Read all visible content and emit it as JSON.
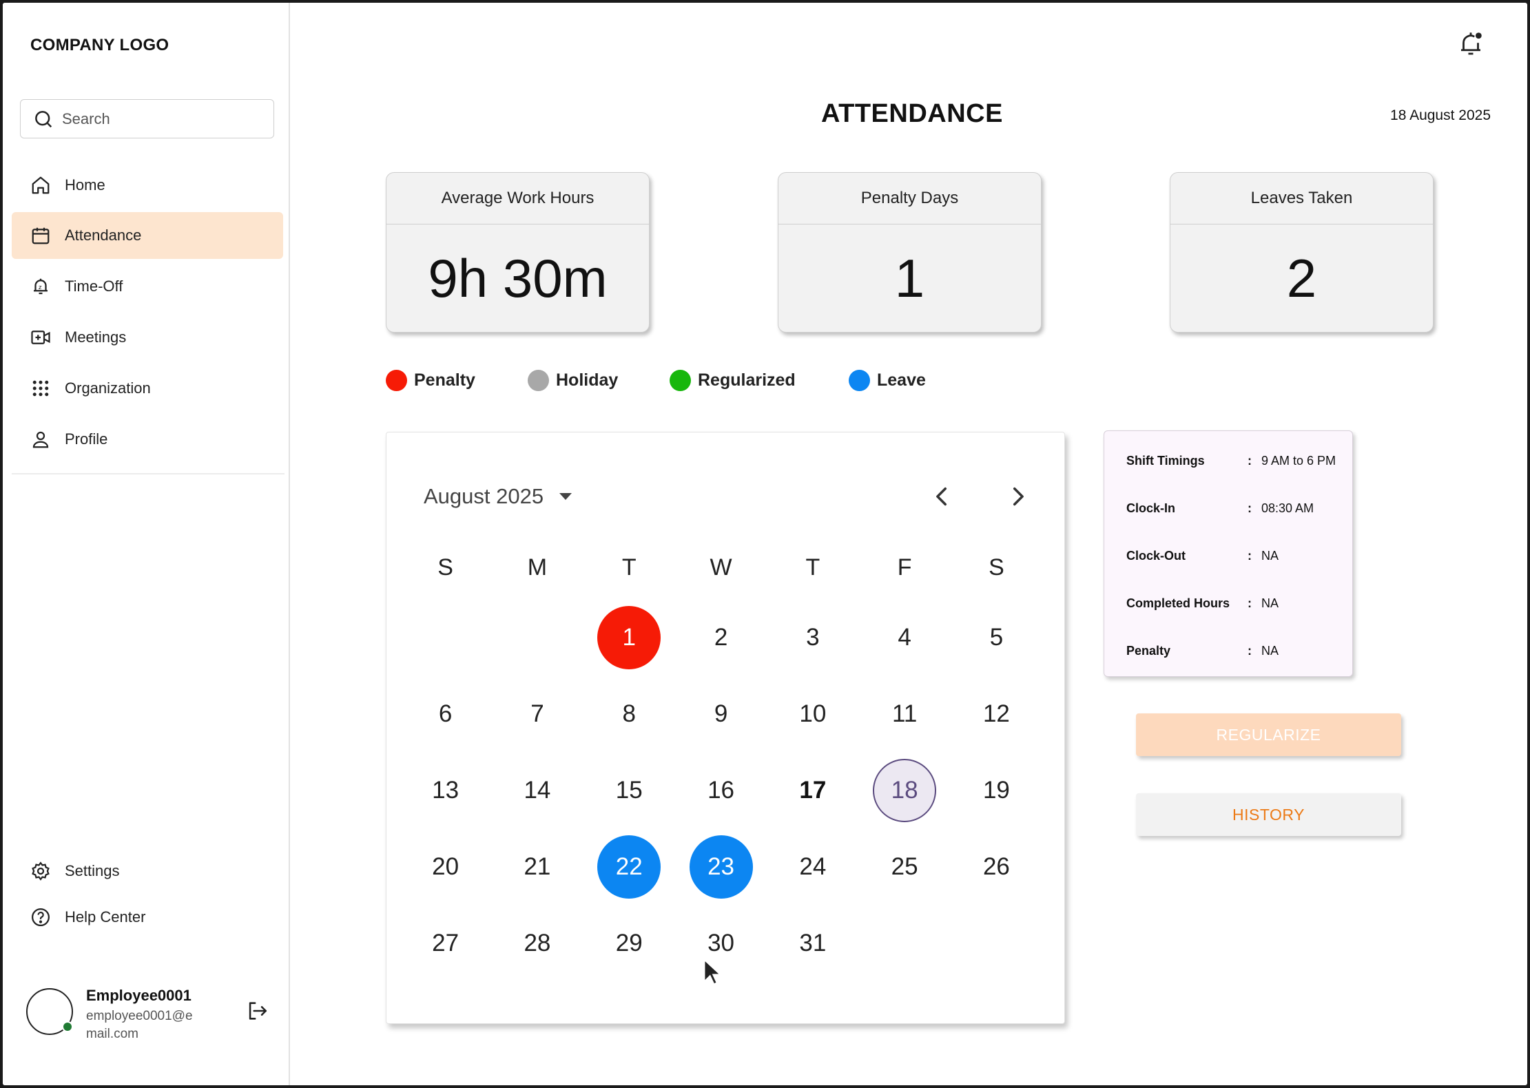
{
  "sidebar": {
    "logo": "COMPANY LOGO",
    "search_placeholder": "Search",
    "nav": [
      {
        "label": "Home",
        "icon": "home-icon"
      },
      {
        "label": "Attendance",
        "icon": "calendar-icon",
        "active": true
      },
      {
        "label": "Time-Off",
        "icon": "time-off-icon"
      },
      {
        "label": "Meetings",
        "icon": "video-add-icon"
      },
      {
        "label": "Organization",
        "icon": "grid-dots-icon"
      },
      {
        "label": "Profile",
        "icon": "user-icon"
      }
    ],
    "bottom_nav": [
      {
        "label": "Settings",
        "icon": "gear-icon"
      },
      {
        "label": "Help Center",
        "icon": "help-circle-icon"
      }
    ],
    "user": {
      "name": "Employee0001",
      "email": "employee0001@email.com",
      "status_color": "#1f7a33"
    }
  },
  "header": {
    "title": "ATTENDANCE",
    "date": "18 August 2025"
  },
  "stats": [
    {
      "label": "Average Work Hours",
      "value": "9h 30m"
    },
    {
      "label": "Penalty Days",
      "value": "1"
    },
    {
      "label": "Leaves Taken",
      "value": "2"
    }
  ],
  "legend": [
    {
      "label": "Penalty",
      "color": "#f61b06"
    },
    {
      "label": "Holiday",
      "color": "#a8a8a8"
    },
    {
      "label": "Regularized",
      "color": "#17b70c"
    },
    {
      "label": "Leave",
      "color": "#0c86f2"
    }
  ],
  "calendar": {
    "month_label": "August 2025",
    "weekdays": [
      "S",
      "M",
      "T",
      "W",
      "T",
      "F",
      "S"
    ],
    "first_weekday_index": 2,
    "days_in_month": 31,
    "penalty_days": [
      1
    ],
    "leave_days": [
      22,
      23
    ],
    "today": 18,
    "bold_days": [
      17
    ]
  },
  "shift_info": {
    "separator": ":",
    "rows": [
      {
        "label": "Shift Timings",
        "value": "9 AM to 6 PM"
      },
      {
        "label": "Clock-In",
        "value": "08:30 AM"
      },
      {
        "label": "Clock-Out",
        "value": "NA"
      },
      {
        "label": "Completed Hours",
        "value": "NA"
      },
      {
        "label": "Penalty",
        "value": "NA"
      }
    ]
  },
  "actions": {
    "regularize_label": "REGULARIZE",
    "history_label": "HISTORY"
  }
}
